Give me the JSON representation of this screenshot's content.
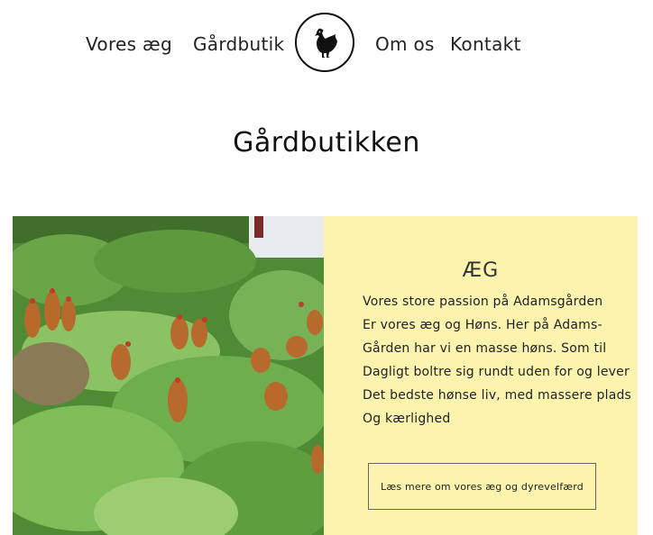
{
  "nav": {
    "items": [
      {
        "label": "Vores æg"
      },
      {
        "label": "Gårdbutik"
      },
      {
        "label": "Om os"
      },
      {
        "label": "Kontakt"
      }
    ],
    "logo_icon": "chicken-icon"
  },
  "page": {
    "title": "Gårdbutikken"
  },
  "feature": {
    "title": "ÆG",
    "lines": [
      "Vores store passion på Adamsgården",
      "Er vores æg og Høns. Her på Adams-",
      "Gården har vi en masse høns. Som til",
      "Dagligt boltre sig rundt uden for og lever",
      "Det bedste hønse liv, med massere plads",
      "Og kærlighed"
    ],
    "button_label": "Læs mere om vores æg og dyrevelfærd",
    "panel_color": "#fbf3ae",
    "photo_description_icon": "chickens-in-field-photo"
  }
}
